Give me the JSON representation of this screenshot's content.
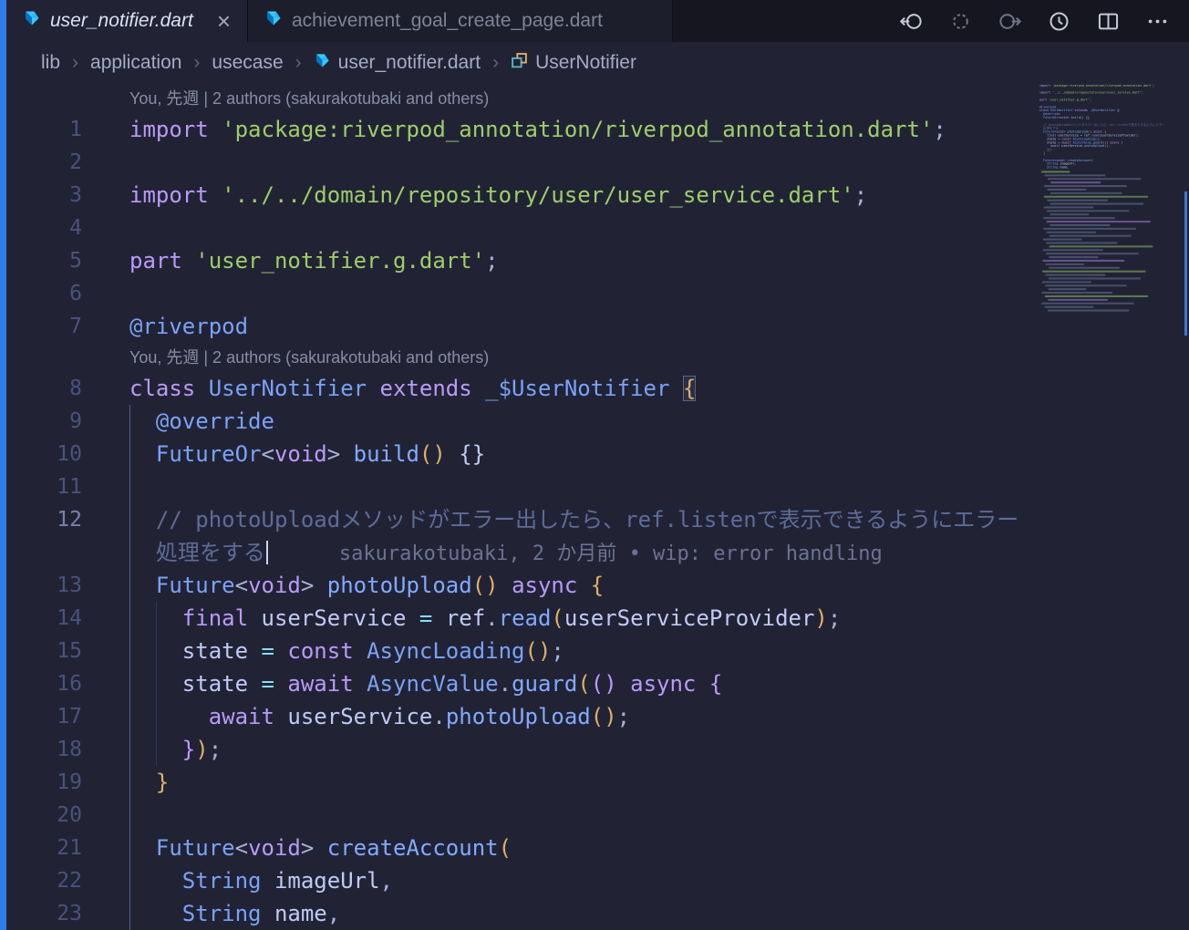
{
  "tabs": {
    "items": [
      {
        "label": "user_notifier.dart",
        "icon": "dart-icon",
        "state": "active",
        "close": "×"
      },
      {
        "label": "achievement_goal_create_page.dart",
        "icon": "dart-icon",
        "state": "inactive"
      }
    ]
  },
  "editor_actions": [
    "debug-step-back-icon",
    "breakpoint-circle-icon",
    "debug-step-out-icon",
    "timeline-icon",
    "split-editor-icon",
    "more-actions-icon"
  ],
  "breadcrumb": {
    "separator": "›",
    "items": [
      {
        "label": "lib"
      },
      {
        "label": "application"
      },
      {
        "label": "usecase"
      },
      {
        "label": "user_notifier.dart",
        "icon": "dart-icon"
      },
      {
        "label": "UserNotifier",
        "icon": "symbol-class-icon"
      }
    ]
  },
  "codelens_text": "You, 先週 | 2 authors (sakurakotubaki and others)",
  "blame_text": "sakurakotubaki, 2 か月前 • wip: error handling",
  "colors": {
    "accent": "#2e7de9",
    "background": "#212335",
    "keyword": "#bb9af7",
    "string": "#9ece6a",
    "type": "#7aa2f7",
    "bracket_gold": "#e0af68",
    "bracket_purple": "#c099ff",
    "comment": "#5f6b99"
  },
  "code": {
    "rows": [
      {
        "type": "codelens"
      },
      {
        "n": "1",
        "t": [
          [
            "k",
            "import"
          ],
          [
            "v",
            " "
          ],
          [
            "s",
            "'package:riverpod_annotation/riverpod_annotation.dart'"
          ],
          [
            "p",
            ";"
          ]
        ]
      },
      {
        "n": "2",
        "t": []
      },
      {
        "n": "3",
        "t": [
          [
            "k",
            "import"
          ],
          [
            "v",
            " "
          ],
          [
            "s",
            "'../../domain/repository/user/user_service.dart'"
          ],
          [
            "p",
            ";"
          ]
        ]
      },
      {
        "n": "4",
        "t": []
      },
      {
        "n": "5",
        "t": [
          [
            "k",
            "part"
          ],
          [
            "v",
            " "
          ],
          [
            "s",
            "'user_notifier.g.dart'"
          ],
          [
            "p",
            ";"
          ]
        ]
      },
      {
        "n": "6",
        "t": []
      },
      {
        "n": "7",
        "t": [
          [
            "a",
            "@riverpod"
          ]
        ]
      },
      {
        "type": "codelens"
      },
      {
        "n": "8",
        "t": [
          [
            "k",
            "class"
          ],
          [
            "v",
            " "
          ],
          [
            "t2",
            "UserNotifier"
          ],
          [
            "v",
            " "
          ],
          [
            "k",
            "extends"
          ],
          [
            "v",
            " "
          ],
          [
            "t2",
            "_$UserNotifier"
          ],
          [
            "v",
            " "
          ],
          [
            "mb",
            "{"
          ]
        ]
      },
      {
        "n": "9",
        "t": [
          [
            "v",
            "  "
          ],
          [
            "a",
            "@override"
          ]
        ]
      },
      {
        "n": "10",
        "t": [
          [
            "v",
            "  "
          ],
          [
            "t2",
            "FutureOr"
          ],
          [
            "p",
            "<"
          ],
          [
            "k",
            "void"
          ],
          [
            "p",
            ">"
          ],
          [
            "v",
            " "
          ],
          [
            "f",
            "build"
          ],
          [
            "g1",
            "()"
          ],
          [
            "v",
            " "
          ],
          [
            "v",
            "{}"
          ]
        ]
      },
      {
        "n": "11",
        "t": []
      },
      {
        "n": "12",
        "t": [
          [
            "c",
            "  // photoUploadメソッドがエラー出したら、ref.listenで表示できるようにエラー"
          ]
        ]
      },
      {
        "n": "",
        "t": [
          [
            "c",
            "  処理をする"
          ]
        ],
        "cursor": true,
        "blame": true
      },
      {
        "n": "13",
        "t": [
          [
            "v",
            "  "
          ],
          [
            "t2",
            "Future"
          ],
          [
            "p",
            "<"
          ],
          [
            "k",
            "void"
          ],
          [
            "p",
            ">"
          ],
          [
            "v",
            " "
          ],
          [
            "f",
            "photoUpload"
          ],
          [
            "g1",
            "()"
          ],
          [
            "v",
            " "
          ],
          [
            "k",
            "async"
          ],
          [
            "v",
            " "
          ],
          [
            "g1",
            "{"
          ]
        ]
      },
      {
        "n": "14",
        "t": [
          [
            "v",
            "    "
          ],
          [
            "k",
            "final"
          ],
          [
            "v",
            " "
          ],
          [
            "v",
            "userService"
          ],
          [
            "v",
            " "
          ],
          [
            "o",
            "="
          ],
          [
            "v",
            " "
          ],
          [
            "v",
            "ref"
          ],
          [
            "p",
            "."
          ],
          [
            "f",
            "read"
          ],
          [
            "g1",
            "("
          ],
          [
            "v",
            "userServiceProvider"
          ],
          [
            "g1",
            ")"
          ],
          [
            "p",
            ";"
          ]
        ]
      },
      {
        "n": "15",
        "t": [
          [
            "v",
            "    "
          ],
          [
            "v",
            "state"
          ],
          [
            "v",
            " "
          ],
          [
            "o",
            "="
          ],
          [
            "v",
            " "
          ],
          [
            "k",
            "const"
          ],
          [
            "v",
            " "
          ],
          [
            "t2",
            "AsyncLoading"
          ],
          [
            "g1",
            "()"
          ],
          [
            "p",
            ";"
          ]
        ]
      },
      {
        "n": "16",
        "t": [
          [
            "v",
            "    "
          ],
          [
            "v",
            "state"
          ],
          [
            "v",
            " "
          ],
          [
            "o",
            "="
          ],
          [
            "v",
            " "
          ],
          [
            "k",
            "await"
          ],
          [
            "v",
            " "
          ],
          [
            "t2",
            "AsyncValue"
          ],
          [
            "p",
            "."
          ],
          [
            "f",
            "guard"
          ],
          [
            "g1",
            "("
          ],
          [
            "g2",
            "()"
          ],
          [
            "v",
            " "
          ],
          [
            "k",
            "async"
          ],
          [
            "v",
            " "
          ],
          [
            "g2",
            "{"
          ]
        ]
      },
      {
        "n": "17",
        "t": [
          [
            "v",
            "      "
          ],
          [
            "k",
            "await"
          ],
          [
            "v",
            " "
          ],
          [
            "v",
            "userService"
          ],
          [
            "p",
            "."
          ],
          [
            "f",
            "photoUpload"
          ],
          [
            "g1",
            "()"
          ],
          [
            "p",
            ";"
          ]
        ]
      },
      {
        "n": "18",
        "t": [
          [
            "v",
            "    "
          ],
          [
            "g2",
            "}"
          ],
          [
            "g1",
            ")"
          ],
          [
            "p",
            ";"
          ]
        ]
      },
      {
        "n": "19",
        "t": [
          [
            "v",
            "  "
          ],
          [
            "g1",
            "}"
          ]
        ]
      },
      {
        "n": "20",
        "t": []
      },
      {
        "n": "21",
        "t": [
          [
            "v",
            "  "
          ],
          [
            "t2",
            "Future"
          ],
          [
            "p",
            "<"
          ],
          [
            "k",
            "void"
          ],
          [
            "p",
            ">"
          ],
          [
            "v",
            " "
          ],
          [
            "f",
            "createAccount"
          ],
          [
            "g1",
            "("
          ]
        ]
      },
      {
        "n": "22",
        "t": [
          [
            "v",
            "    "
          ],
          [
            "t2",
            "String"
          ],
          [
            "v",
            " "
          ],
          [
            "v",
            "imageUrl"
          ],
          [
            "p",
            ","
          ]
        ]
      },
      {
        "n": "23",
        "t": [
          [
            "v",
            "    "
          ],
          [
            "t2",
            "String"
          ],
          [
            "v",
            " "
          ],
          [
            "v",
            "name"
          ],
          [
            "p",
            ","
          ]
        ]
      }
    ]
  }
}
